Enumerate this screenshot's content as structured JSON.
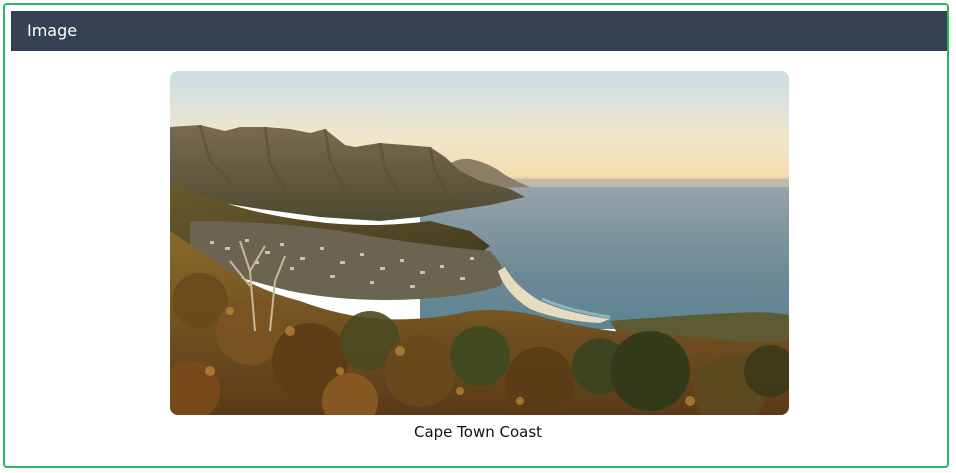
{
  "panel": {
    "title": "Image"
  },
  "image": {
    "caption": "Cape Town Coast",
    "subject": "coastal-landscape-photo"
  },
  "colors": {
    "header_bg": "#334152",
    "border": "#2fb562"
  }
}
